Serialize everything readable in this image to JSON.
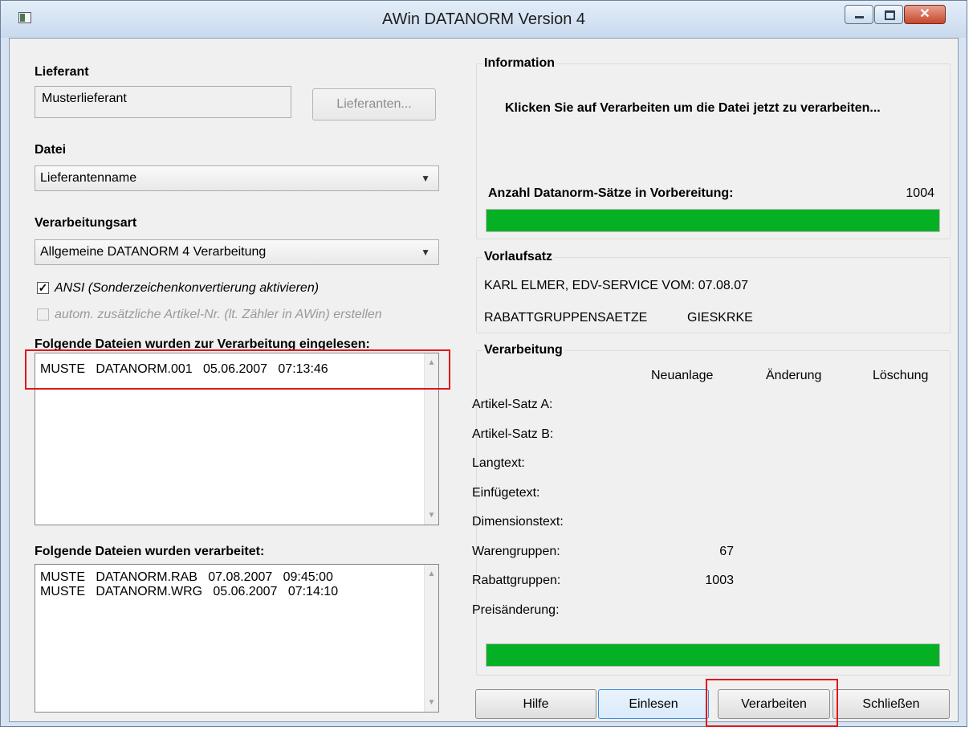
{
  "window": {
    "title": "AWin  DATANORM Version 4",
    "close_glyph": "✕"
  },
  "lieferant": {
    "label": "Lieferant",
    "value": "Musterlieferant",
    "button": "Lieferanten..."
  },
  "datei": {
    "label": "Datei",
    "selected": "Lieferantenname"
  },
  "verarbeitungsart": {
    "label": "Verarbeitungsart",
    "selected": "Allgemeine DATANORM 4 Verarbeitung"
  },
  "options": {
    "ansi": {
      "label": "ANSI (Sonderzeichenkonvertierung aktivieren)",
      "checked": true,
      "mark": "✓"
    },
    "autom": {
      "label": "autom. zusätzliche Artikel-Nr. (lt. Zähler in AWin) erstellen",
      "checked": false
    }
  },
  "eingelesen": {
    "label": "Folgende Dateien wurden zur Verarbeitung eingelesen:",
    "rows": [
      "MUSTE   DATANORM.001   05.06.2007   07:13:46"
    ]
  },
  "verarbeitet": {
    "label": "Folgende Dateien wurden verarbeitet:",
    "rows": [
      "MUSTE   DATANORM.RAB   07.08.2007   09:45:00",
      "MUSTE   DATANORM.WRG   05.06.2007   07:14:10"
    ]
  },
  "scroll": {
    "up": "▲",
    "down": "▼"
  },
  "information": {
    "title": "Information",
    "message": "Klicken Sie auf Verarbeiten um die Datei jetzt zu verarbeiten...",
    "count_label": "Anzahl Datanorm-Sätze in Vorbereitung:",
    "count_value": "1004",
    "progress": 1.0
  },
  "vorlaufsatz": {
    "title": "Vorlaufsatz",
    "line1": "KARL ELMER, EDV-SERVICE VOM: 07.08.07",
    "line2_a": "RABATTGRUPPENSAETZE",
    "line2_b": "GIESKRKE"
  },
  "verarbeitung": {
    "title": "Verarbeitung",
    "columns": [
      "Neuanlage",
      "Änderung",
      "Löschung"
    ],
    "rows": [
      {
        "label": "Artikel-Satz A:",
        "neu": ""
      },
      {
        "label": "Artikel-Satz B:",
        "neu": ""
      },
      {
        "label": "Langtext:",
        "neu": ""
      },
      {
        "label": "Einfügetext:",
        "neu": ""
      },
      {
        "label": "Dimensionstext:",
        "neu": ""
      },
      {
        "label": "Warengruppen:",
        "neu": "67"
      },
      {
        "label": "Rabattgruppen:",
        "neu": "1003"
      },
      {
        "label": "Preisänderung:",
        "neu": ""
      }
    ],
    "progress": 1.0
  },
  "buttons": {
    "hilfe": "Hilfe",
    "einlesen": "Einlesen",
    "verarbeiten": "Verarbeiten",
    "schliessen": "Schließen"
  },
  "colors": {
    "progress": "#06b025",
    "highlight": "#e01818",
    "focus": "#3a8be0"
  }
}
